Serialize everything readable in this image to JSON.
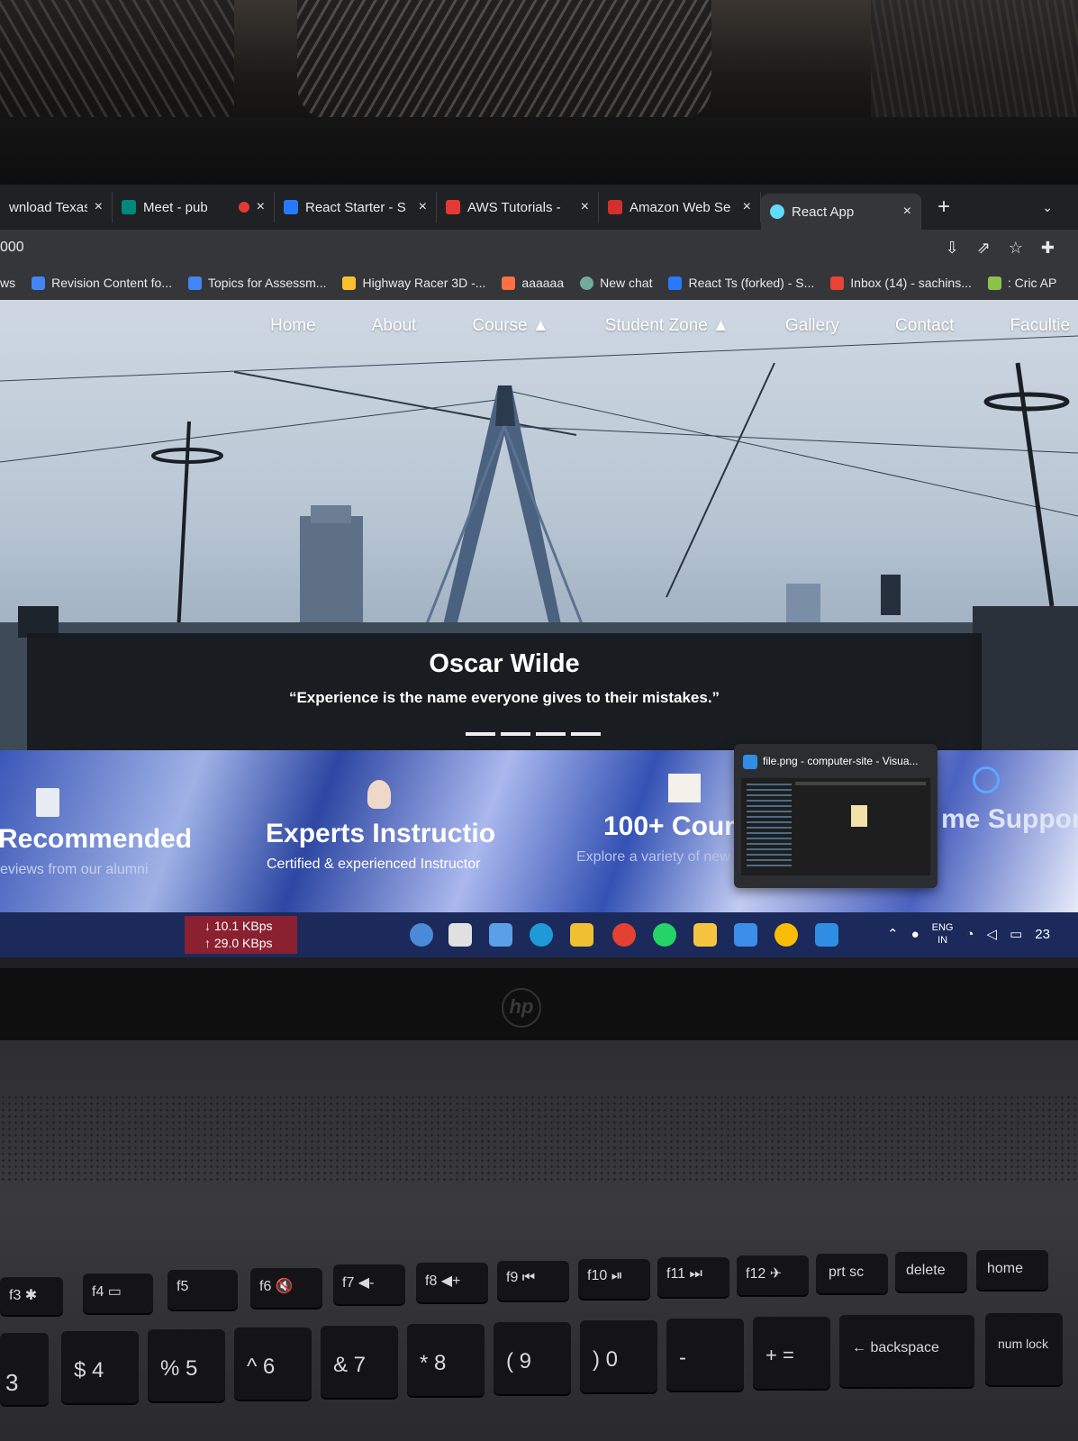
{
  "tabs": [
    {
      "title": "wnload Texas",
      "close": "×",
      "color": "#4285f4"
    },
    {
      "title": "Meet - pub",
      "close": "×",
      "color": "#00897b"
    },
    {
      "title": "React Starter - S",
      "close": "×",
      "color": "#2979ff"
    },
    {
      "title": "AWS Tutorials -",
      "close": "×",
      "color": "#e53935"
    },
    {
      "title": "Amazon Web Se",
      "close": "×",
      "color": "#d32f2f"
    },
    {
      "title": "React App",
      "close": "×",
      "color": "#61dafb",
      "active": true
    }
  ],
  "tab_new": "+",
  "tab_menu": "⌄",
  "address": {
    "url": "000"
  },
  "bookmarks": [
    {
      "label": "ws",
      "color": "#9e9e9e"
    },
    {
      "label": "Revision Content fo...",
      "color": "#4285f4"
    },
    {
      "label": "Topics for Assessm...",
      "color": "#4285f4"
    },
    {
      "label": "Highway Racer 3D -...",
      "color": "#fbc02d"
    },
    {
      "label": "aaaaaa",
      "color": "#ff7043"
    },
    {
      "label": "New chat",
      "color": "#74aa9c"
    },
    {
      "label": "React Ts (forked) - S...",
      "color": "#2979ff"
    },
    {
      "label": "Inbox (14) - sachins...",
      "color": "#ea4335"
    },
    {
      "label": ": Cric AP",
      "color": "#8bc34a"
    }
  ],
  "nav": [
    "Home",
    "About",
    "Course ▲",
    "Student Zone ▲",
    "Gallery",
    "Contact",
    "Facultie"
  ],
  "quote": {
    "author": "Oscar Wilde",
    "text": "“Experience is the name everyone gives to their mistakes.”"
  },
  "features": [
    {
      "heading": "Recommended",
      "sub": "eviews from our alumni",
      "icon": "document-icon"
    },
    {
      "heading": "Experts Instructio",
      "sub": "Certified & experienced Instructor",
      "icon": "person-icon"
    },
    {
      "heading": "100+ Cour",
      "sub": "Explore a variety of new",
      "icon": "book-icon"
    },
    {
      "heading": "me Suppor",
      "sub": "",
      "icon": "clock-icon"
    }
  ],
  "preview": {
    "title": "file.png - computer-site - Visua..."
  },
  "taskbar": {
    "down": "↓ 10.1 KBps",
    "up": "↑ 29.0 KBps",
    "lang_top": "ENG",
    "lang_bottom": "IN",
    "time": "23"
  },
  "keyboard": {
    "fn_row": [
      "f3 ✱",
      "f4 ▭",
      "f5",
      "f6 🔇",
      "f7 ◀-",
      "f8 ◀+",
      "f9 ⏮",
      "f10 ⏯",
      "f11 ⏭",
      "f12 ✈",
      "prt sc",
      "delete",
      "home"
    ],
    "num_row": [
      "3",
      "$ 4",
      "% 5",
      "^ 6",
      "& 7",
      "* 8",
      "( 9",
      ") 0",
      "-",
      "+ =",
      "← backspace",
      "num lock"
    ],
    "brand": "hp"
  }
}
